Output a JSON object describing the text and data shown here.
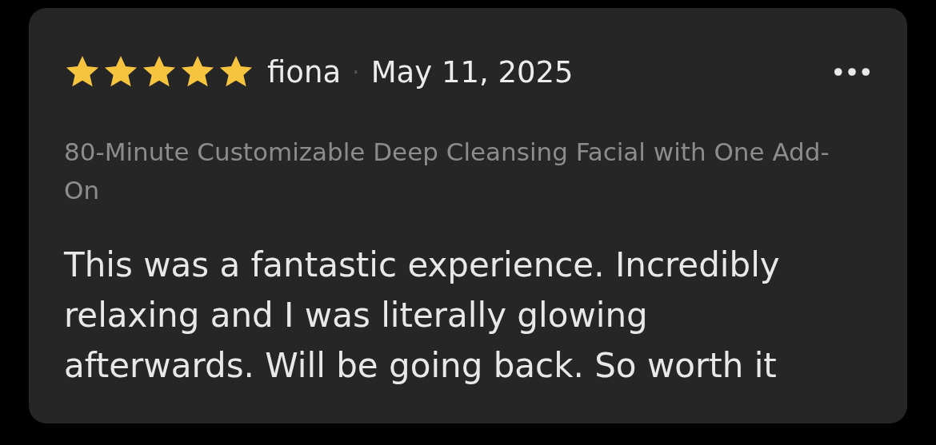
{
  "review": {
    "stars": 5,
    "author": "fiona",
    "separator": "·",
    "date": "May 11, 2025",
    "service": "80-Minute Customizable Deep Cleansing Facial with One Add-On",
    "body": "This was a fantastic experience. Incredibly relaxing and I was literally glowing afterwards. Will be going back. So worth it"
  }
}
